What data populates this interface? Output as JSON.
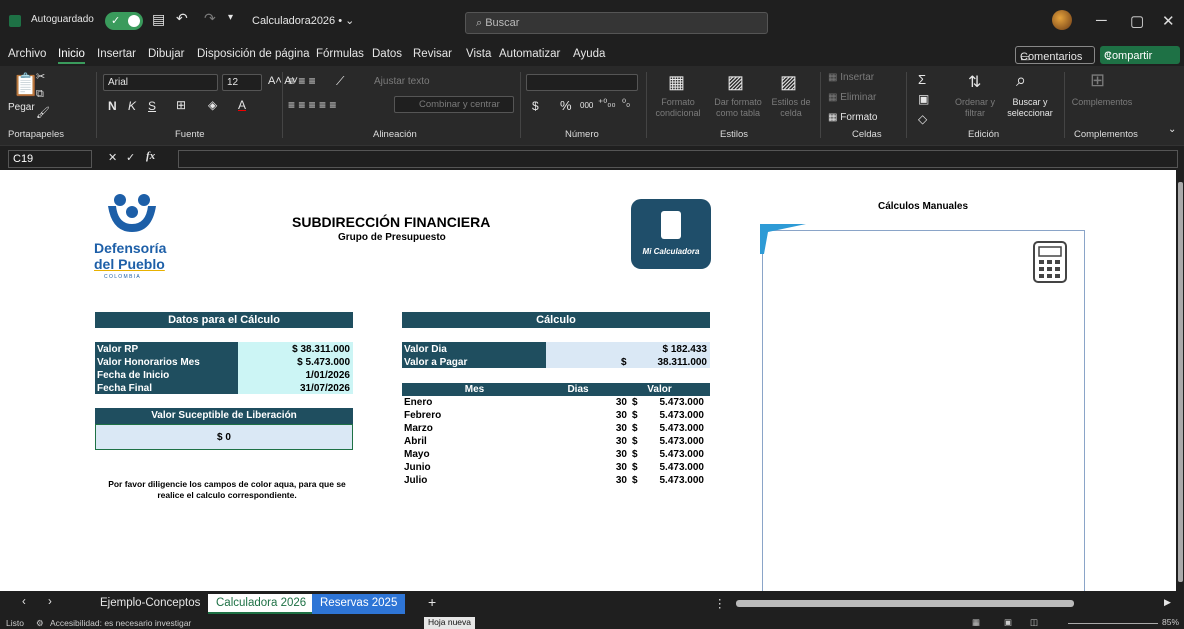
{
  "titlebar": {
    "autosave": "Autoguardado",
    "toggle_mark": "✓",
    "file": "Calculadora2026 • ⌄",
    "search": "Buscar"
  },
  "menu": {
    "items": [
      "Archivo",
      "Inicio",
      "Insertar",
      "Dibujar",
      "Disposición de página",
      "Fórmulas",
      "Datos",
      "Revisar",
      "Vista",
      "Automatizar",
      "Ayuda"
    ],
    "comments": "Comentarios",
    "share": "Compartir"
  },
  "ribbon": {
    "paste": "Pegar",
    "font_name": "Arial",
    "font_size": "12",
    "wrap": "Ajustar texto",
    "merge": "Combinar y centrar",
    "currency": "$",
    "percent": "%",
    "thousands": "000",
    "dec_inc": "⁺⁰₀₀",
    "dec_dec": "⁰₀",
    "cond_format": "Formato condicional",
    "table_format": "Dar formato como tabla",
    "cell_styles": "Estilos de celda",
    "insert": "Insertar",
    "delete": "Eliminar",
    "format": "Formato",
    "sort": "Ordenar y filtrar",
    "find": "Buscar y seleccionar",
    "addins": "Complementos",
    "groups": [
      "Portapapeles",
      "Fuente",
      "Alineación",
      "Número",
      "Estilos",
      "Celdas",
      "Edición",
      "Complementos"
    ]
  },
  "formula_bar": {
    "name_box": "C19",
    "fx": "fx"
  },
  "sheet": {
    "logo_line1": "Defensoría",
    "logo_line2": "del Pueblo",
    "logo_line3": "C O L O M B I A",
    "title": "SUBDIRECCIÓN FINANCIERA",
    "subtitle": "Grupo de Presupuesto",
    "app_logo": "Mi Calculadora",
    "manual_title": "Cálculos Manuales",
    "datos_header": "Datos para el Cálculo",
    "datos": [
      {
        "label": "Valor RP",
        "value": "$ 38.311.000"
      },
      {
        "label": "Valor Honorarios Mes",
        "value": "$ 5.473.000"
      },
      {
        "label": "Fecha de Inicio",
        "value": "1/01/2026"
      },
      {
        "label": "Fecha Final",
        "value": "31/07/2026"
      }
    ],
    "liberacion_header": "Valor Suceptible de Liberación",
    "liberacion_value": "$ 0",
    "nota_1": "Por favor diligencie los campos de color aqua, para que se",
    "nota_2": "realice el calculo correspondiente.",
    "calculo_header": "Cálculo",
    "valor_dia_label": "Valor Dia",
    "valor_dia": "$ 182.433",
    "valor_pagar_label": "Valor a Pagar",
    "valor_pagar_sign": "$",
    "valor_pagar": "38.311.000",
    "col_mes": "Mes",
    "col_dias": "Dias",
    "col_valor": "Valor",
    "rows": [
      {
        "mes": "Enero",
        "dias": "30",
        "sign": "$",
        "valor": "5.473.000"
      },
      {
        "mes": "Febrero",
        "dias": "30",
        "sign": "$",
        "valor": "5.473.000"
      },
      {
        "mes": "Marzo",
        "dias": "30",
        "sign": "$",
        "valor": "5.473.000"
      },
      {
        "mes": "Abril",
        "dias": "30",
        "sign": "$",
        "valor": "5.473.000"
      },
      {
        "mes": "Mayo",
        "dias": "30",
        "sign": "$",
        "valor": "5.473.000"
      },
      {
        "mes": "Junio",
        "dias": "30",
        "sign": "$",
        "valor": "5.473.000"
      },
      {
        "mes": "Julio",
        "dias": "30",
        "sign": "$",
        "valor": "5.473.000"
      }
    ]
  },
  "tabs": {
    "items": [
      "Ejemplo-Conceptos",
      "Calculadora 2026",
      "Reservas 2025"
    ],
    "add": "+",
    "tooltip": "Hoja nueva"
  },
  "status": {
    "ready": "Listo",
    "accessibility": "Accesibilidad: es necesario investigar",
    "zoom": "85%"
  },
  "colors": {
    "accent": "#1e7145",
    "header": "#1f4e5f",
    "aqua": "#ccf5f5"
  }
}
